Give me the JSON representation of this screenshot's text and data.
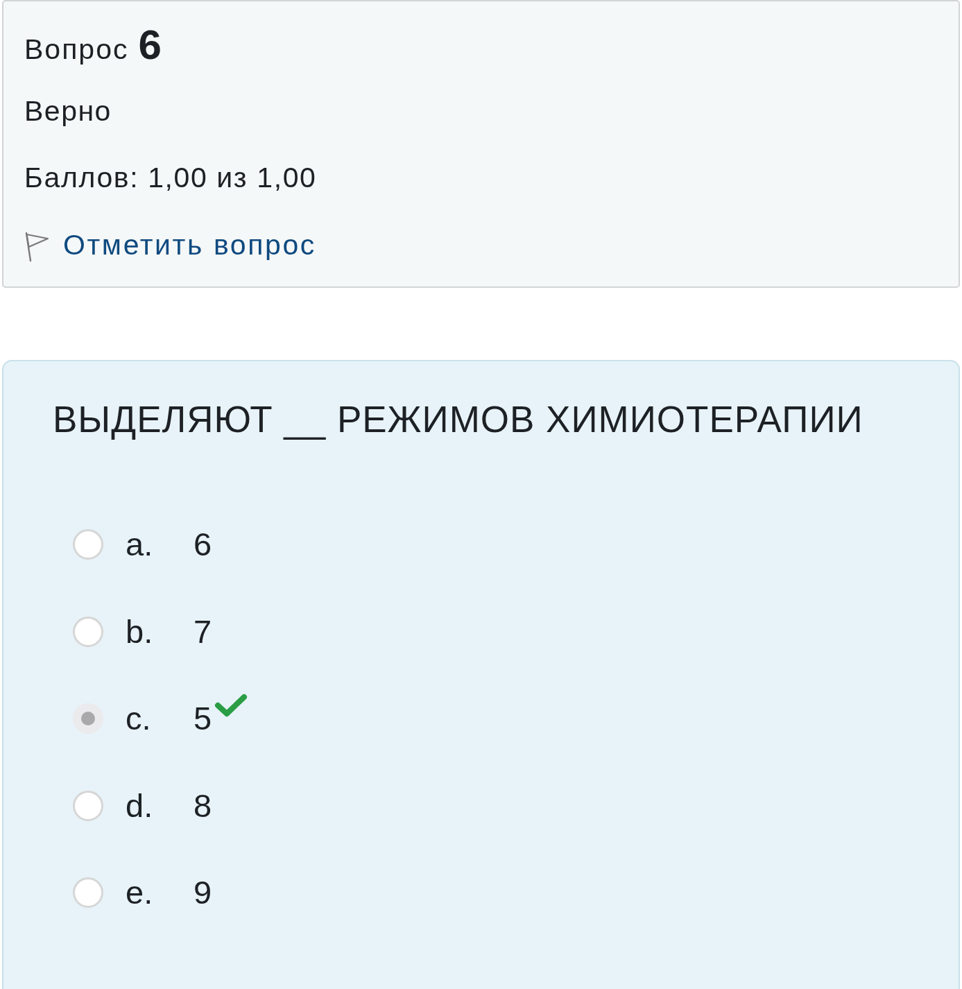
{
  "info": {
    "title_label": "Вопрос",
    "number": "6",
    "status": "Верно",
    "grade": "Баллов: 1,00 из 1,00",
    "flag_link": {
      "label": "Отметить вопрос",
      "flagged": false
    }
  },
  "question": {
    "text": "ВЫДЕЛЯЮТ __ РЕЖИМОВ ХИМИОТЕРАПИИ",
    "options": [
      {
        "letter": "a.",
        "value": "6",
        "selected": false,
        "correct": false
      },
      {
        "letter": "b.",
        "value": "7",
        "selected": false,
        "correct": false
      },
      {
        "letter": "c.",
        "value": "5",
        "selected": true,
        "correct": true
      },
      {
        "letter": "d.",
        "value": "8",
        "selected": false,
        "correct": false
      },
      {
        "letter": "e.",
        "value": "9",
        "selected": false,
        "correct": false
      }
    ]
  }
}
